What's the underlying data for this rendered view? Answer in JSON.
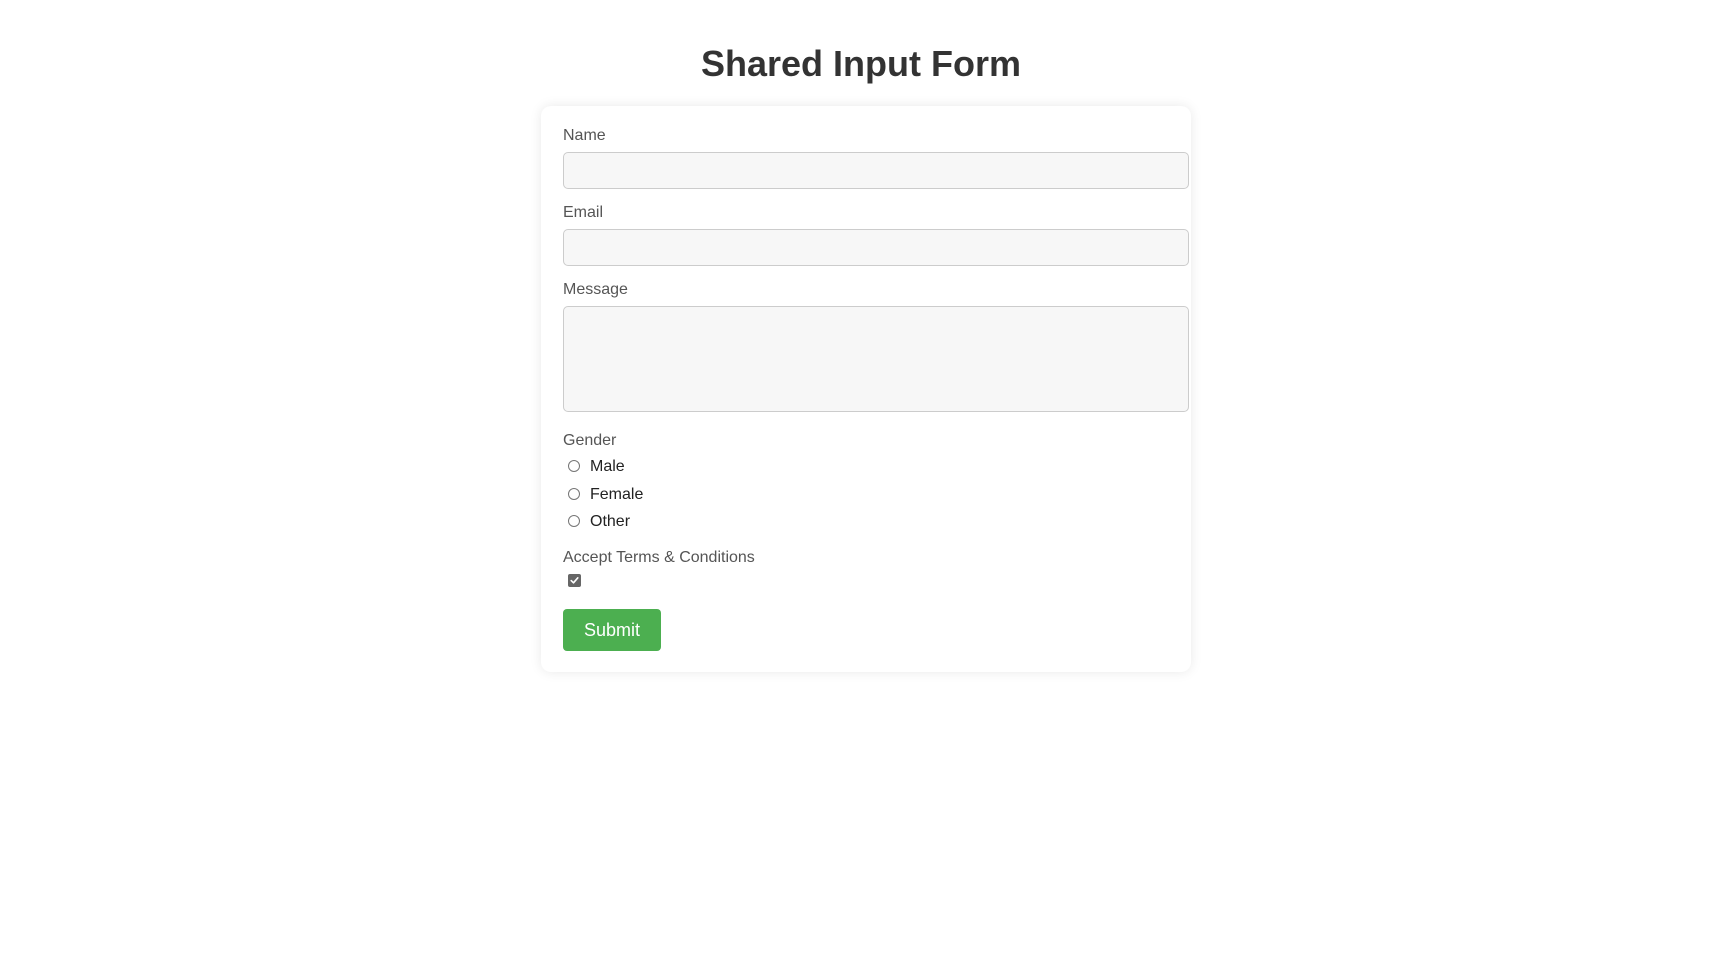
{
  "page": {
    "title": "Shared Input Form"
  },
  "form": {
    "name": {
      "label": "Name",
      "value": "",
      "placeholder": ""
    },
    "email": {
      "label": "Email",
      "value": "",
      "placeholder": ""
    },
    "message": {
      "label": "Message",
      "value": "",
      "placeholder": ""
    },
    "gender": {
      "label": "Gender",
      "options": [
        "Male",
        "Female",
        "Other"
      ],
      "selected": null
    },
    "terms": {
      "label": "Accept Terms & Conditions",
      "checked": true
    },
    "submit_label": "Submit"
  },
  "colors": {
    "submit_bg": "#4caf50",
    "title": "#333333",
    "label": "#555555",
    "field_bg": "#f7f7f7",
    "checkbox_checked": "#666666"
  }
}
